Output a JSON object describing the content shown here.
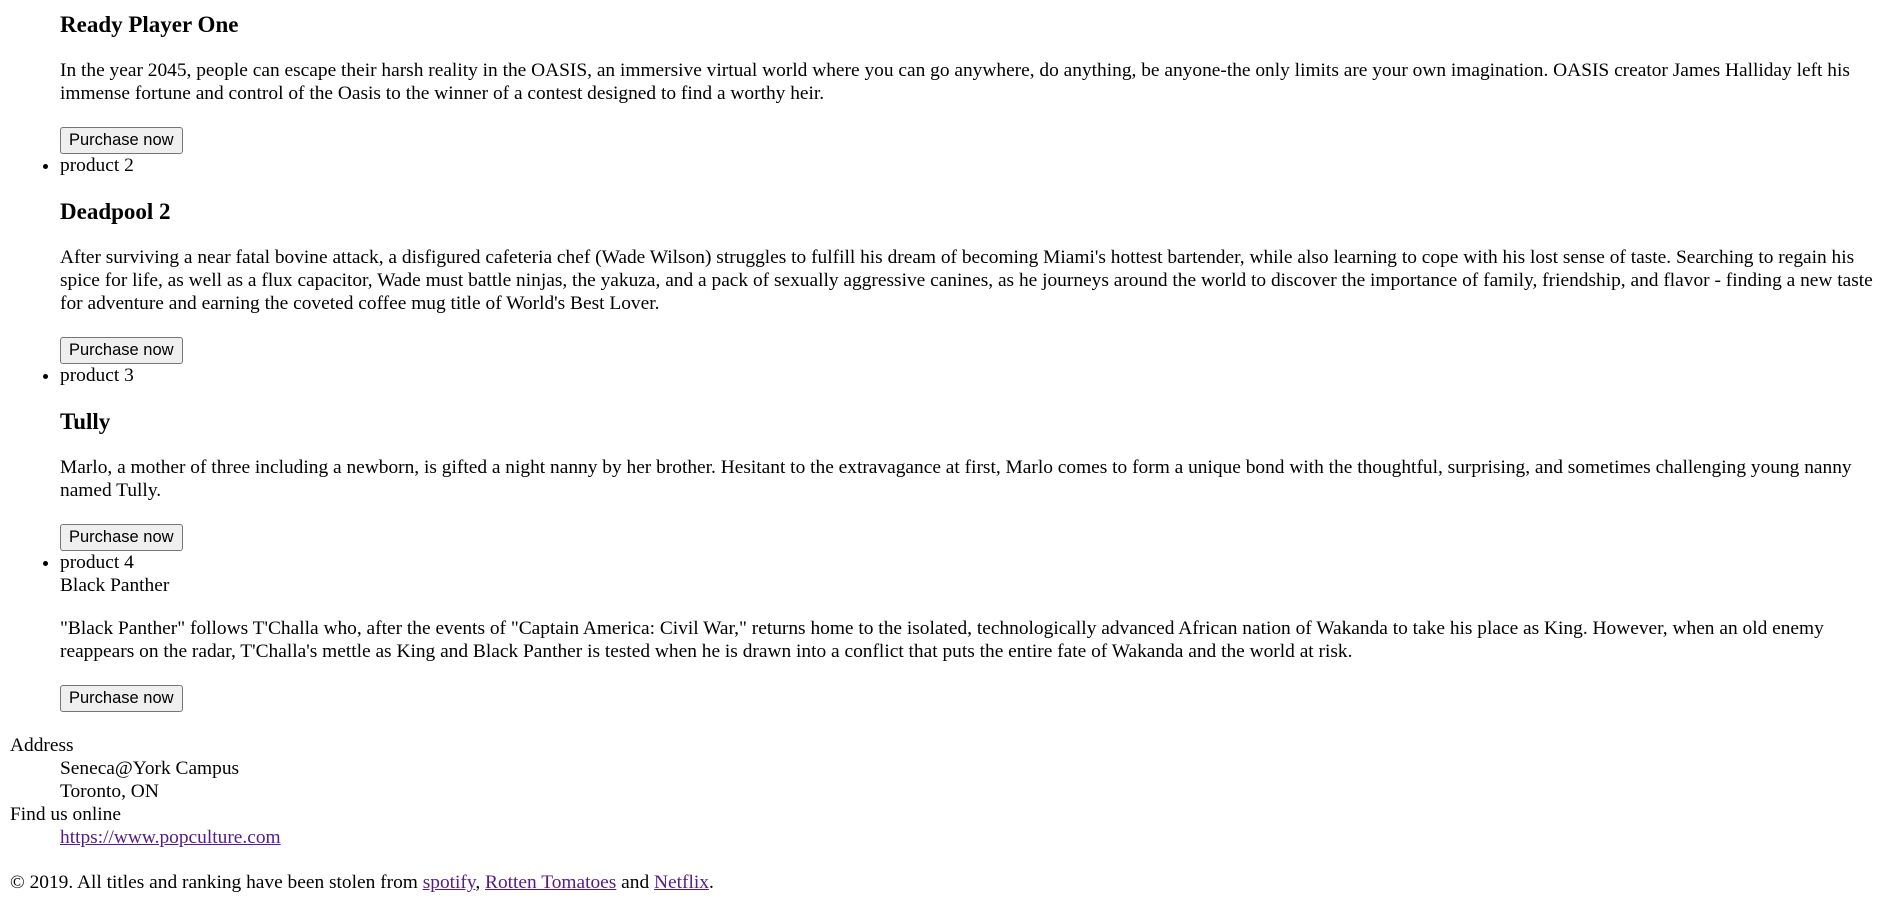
{
  "products": [
    {
      "image_alt": "",
      "title": "Ready Player One",
      "description": "In the year 2045, people can escape their harsh reality in the OASIS, an immersive virtual world where you can go anywhere, do anything, be anyone-the only limits are your own imagination. OASIS creator James Halliday left his immense fortune and control of the Oasis to the winner of a contest designed to find a worthy heir.",
      "button": "Purchase now"
    },
    {
      "image_alt": "product 2",
      "title": "Deadpool 2",
      "description": "After surviving a near fatal bovine attack, a disfigured cafeteria chef (Wade Wilson) struggles to fulfill his dream of becoming Miami's hottest bartender, while also learning to cope with his lost sense of taste. Searching to regain his spice for life, as well as a flux capacitor, Wade must battle ninjas, the yakuza, and a pack of sexually aggressive canines, as he journeys around the world to discover the importance of family, friendship, and flavor - finding a new taste for adventure and earning the coveted coffee mug title of World's Best Lover.",
      "button": "Purchase now"
    },
    {
      "image_alt": "product 3",
      "title": "Tully",
      "description": "Marlo, a mother of three including a newborn, is gifted a night nanny by her brother. Hesitant to the extravagance at first, Marlo comes to form a unique bond with the thoughtful, surprising, and sometimes challenging young nanny named Tully.",
      "button": "Purchase now"
    },
    {
      "image_alt": "product 4",
      "title": "Black Panther",
      "description": "\"Black Panther\" follows T'Challa who, after the events of \"Captain America: Civil War,\" returns home to the isolated, technologically advanced African nation of Wakanda to take his place as King. However, when an old enemy reappears on the radar, T'Challa's mettle as King and Black Panther is tested when he is drawn into a conflict that puts the entire fate of Wakanda and the world at risk.",
      "button": "Purchase now"
    }
  ],
  "contact": {
    "address_label": "Address",
    "address_line1": "Seneca@York Campus",
    "address_line2": "Toronto, ON",
    "online_label": "Find us online",
    "website": "https://www.popculture.com"
  },
  "footer": {
    "prefix": "© 2019. All titles and ranking have been stolen from ",
    "link1": "spotify",
    "sep1": ", ",
    "link2": "Rotten Tomatoes",
    "sep2": " and ",
    "link3": "Netflix",
    "suffix": "."
  }
}
